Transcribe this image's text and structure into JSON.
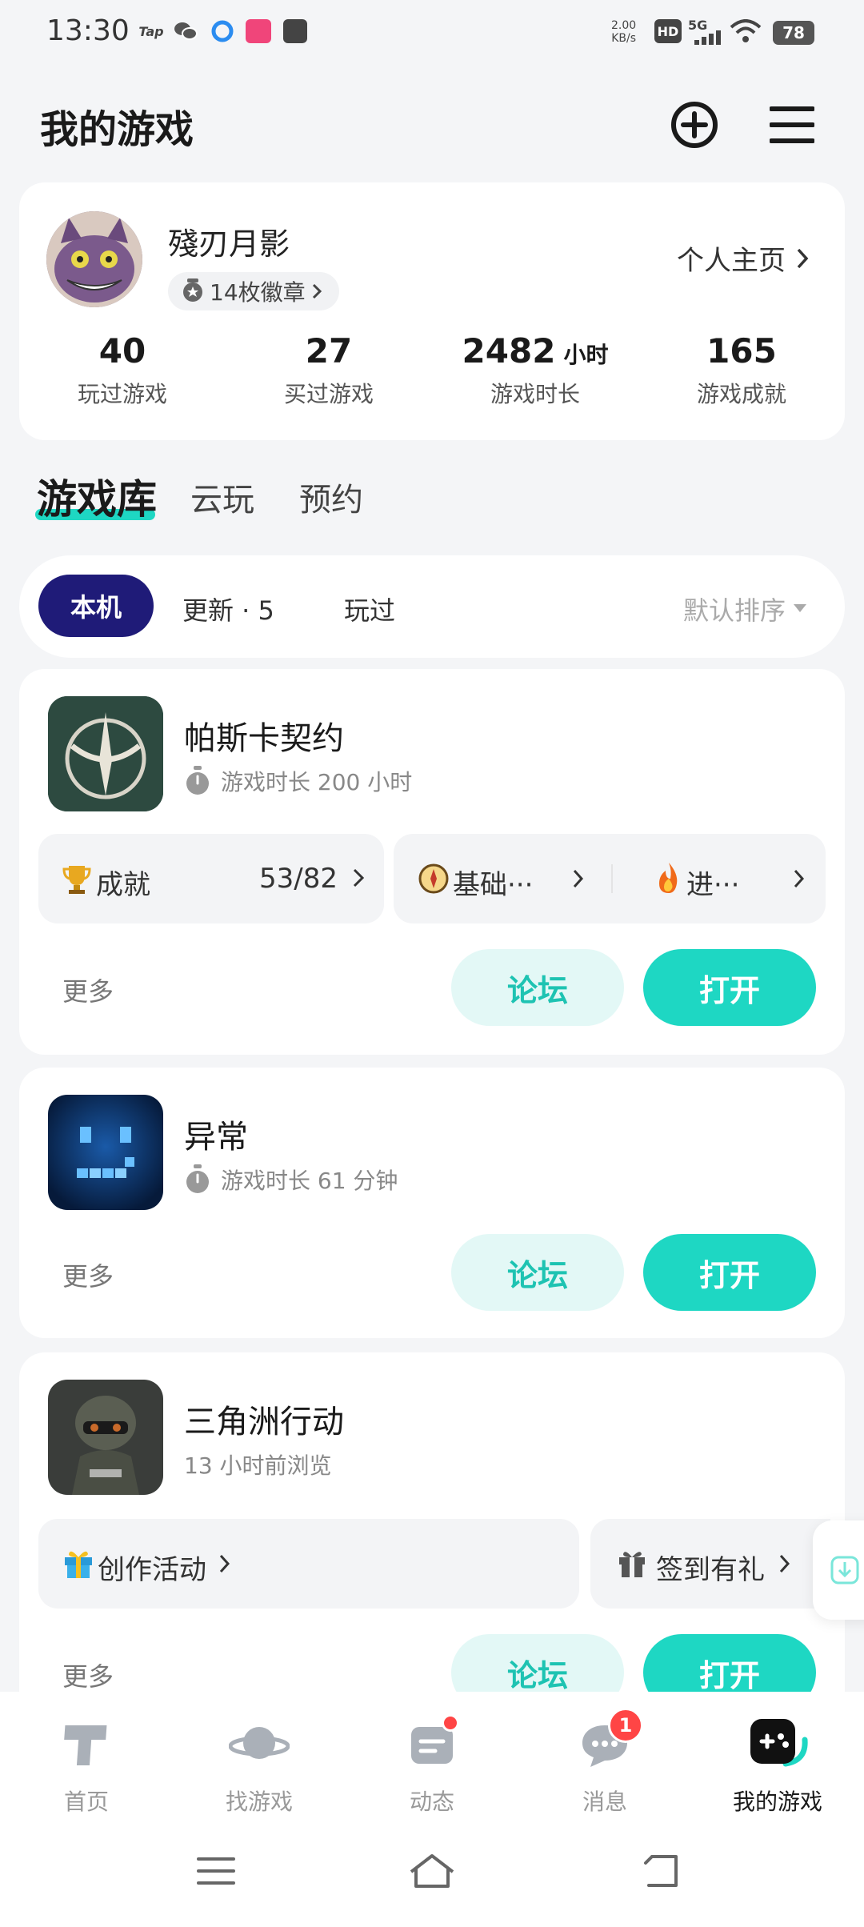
{
  "status_bar": {
    "time": "13:30",
    "left_icons": [
      "taptap-icon",
      "wechat-icon",
      "browser-icon",
      "app-icon",
      "message-icon"
    ],
    "net_speed": "2.00\nKB/s",
    "hd": "HD",
    "signal": "5G",
    "battery": "78"
  },
  "header": {
    "title": "我的游戏",
    "add_icon": "add-circle-icon",
    "menu_icon": "menu-icon"
  },
  "profile": {
    "username": "殘刃月影",
    "badges_label": "14枚徽章",
    "homepage_label": "个人主页",
    "stats": [
      {
        "value": "40",
        "unit": "",
        "label": "玩过游戏"
      },
      {
        "value": "27",
        "unit": "",
        "label": "买过游戏"
      },
      {
        "value": "2482",
        "unit": "小时",
        "label": "游戏时长"
      },
      {
        "value": "165",
        "unit": "",
        "label": "游戏成就"
      }
    ]
  },
  "main_tabs": [
    {
      "label": "游戏库",
      "active": true
    },
    {
      "label": "云玩",
      "active": false
    },
    {
      "label": "预约",
      "active": false
    }
  ],
  "filters": {
    "local": "本机",
    "updates": "更新 · 5",
    "played": "玩过",
    "sort": "默认排序"
  },
  "games": [
    {
      "name": "帕斯卡契约",
      "sub": "游戏时长 200 小时",
      "achievement_label": "成就",
      "achievement_count": "53/82",
      "tag1": "基础···",
      "tag2": "进···",
      "more": "更多",
      "forum": "论坛",
      "open": "打开"
    },
    {
      "name": "异常",
      "sub": "游戏时长 61 分钟",
      "more": "更多",
      "forum": "论坛",
      "open": "打开"
    },
    {
      "name": "三角洲行动",
      "sub": "13 小时前浏览",
      "event1": "创作活动",
      "event2": "签到有礼",
      "more": "更多",
      "forum": "论坛",
      "open": "打开"
    }
  ],
  "bottom_nav": [
    {
      "label": "首页",
      "icon": "home-icon"
    },
    {
      "label": "找游戏",
      "icon": "planet-icon"
    },
    {
      "label": "动态",
      "icon": "feed-icon"
    },
    {
      "label": "消息",
      "icon": "message-icon",
      "badge": "1"
    },
    {
      "label": "我的游戏",
      "icon": "gamepad-icon",
      "active": true
    }
  ],
  "colors": {
    "accent": "#1ed7c3",
    "chip_active": "#1f1b78",
    "badge_red": "#ff4545"
  }
}
